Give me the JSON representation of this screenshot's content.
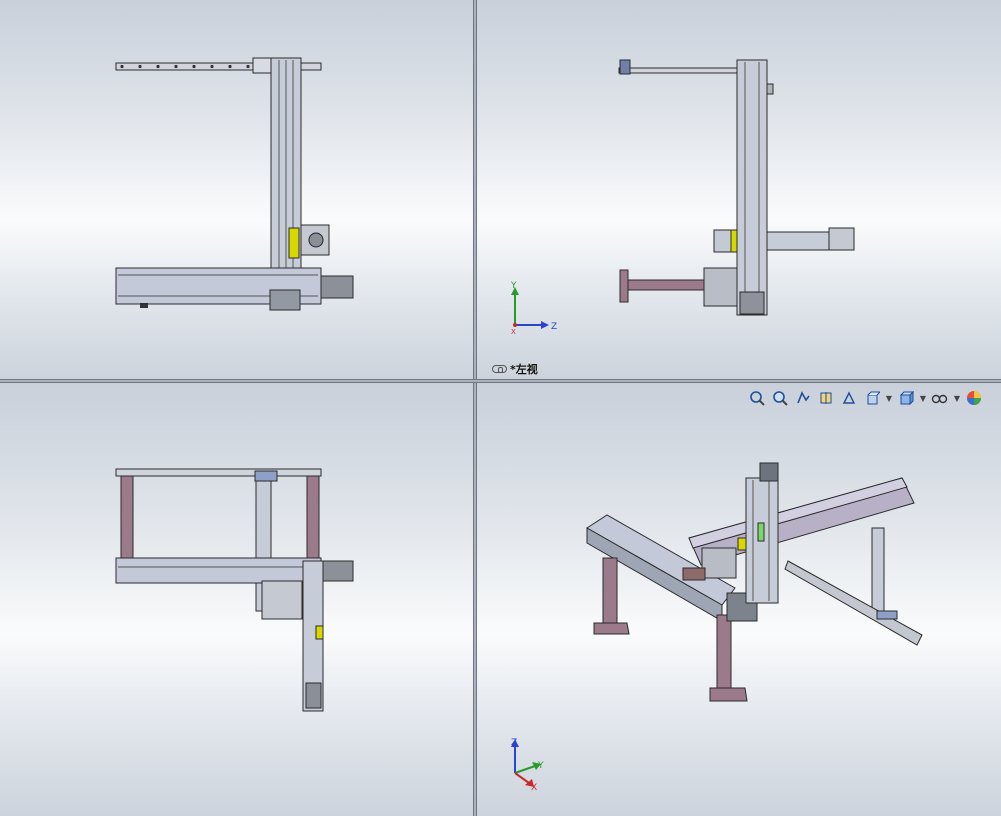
{
  "view_label": "*左视",
  "triad": {
    "y": "Y",
    "z": "Z",
    "x": "X"
  },
  "toolbar": {
    "items": [
      "zoom-to-fit-icon",
      "zoom-to-area-icon",
      "previous-view-icon",
      "section-view-icon",
      "dynamic-annotation-icon",
      "view-orientation-icon",
      "display-style-icon",
      "hide-show-items-icon",
      "edit-appearance-icon"
    ]
  },
  "colors": {
    "rail": "#c6ccd8",
    "leg": "#9b7a8b",
    "accent": "#d8d800",
    "outline": "#2b2b2b"
  }
}
